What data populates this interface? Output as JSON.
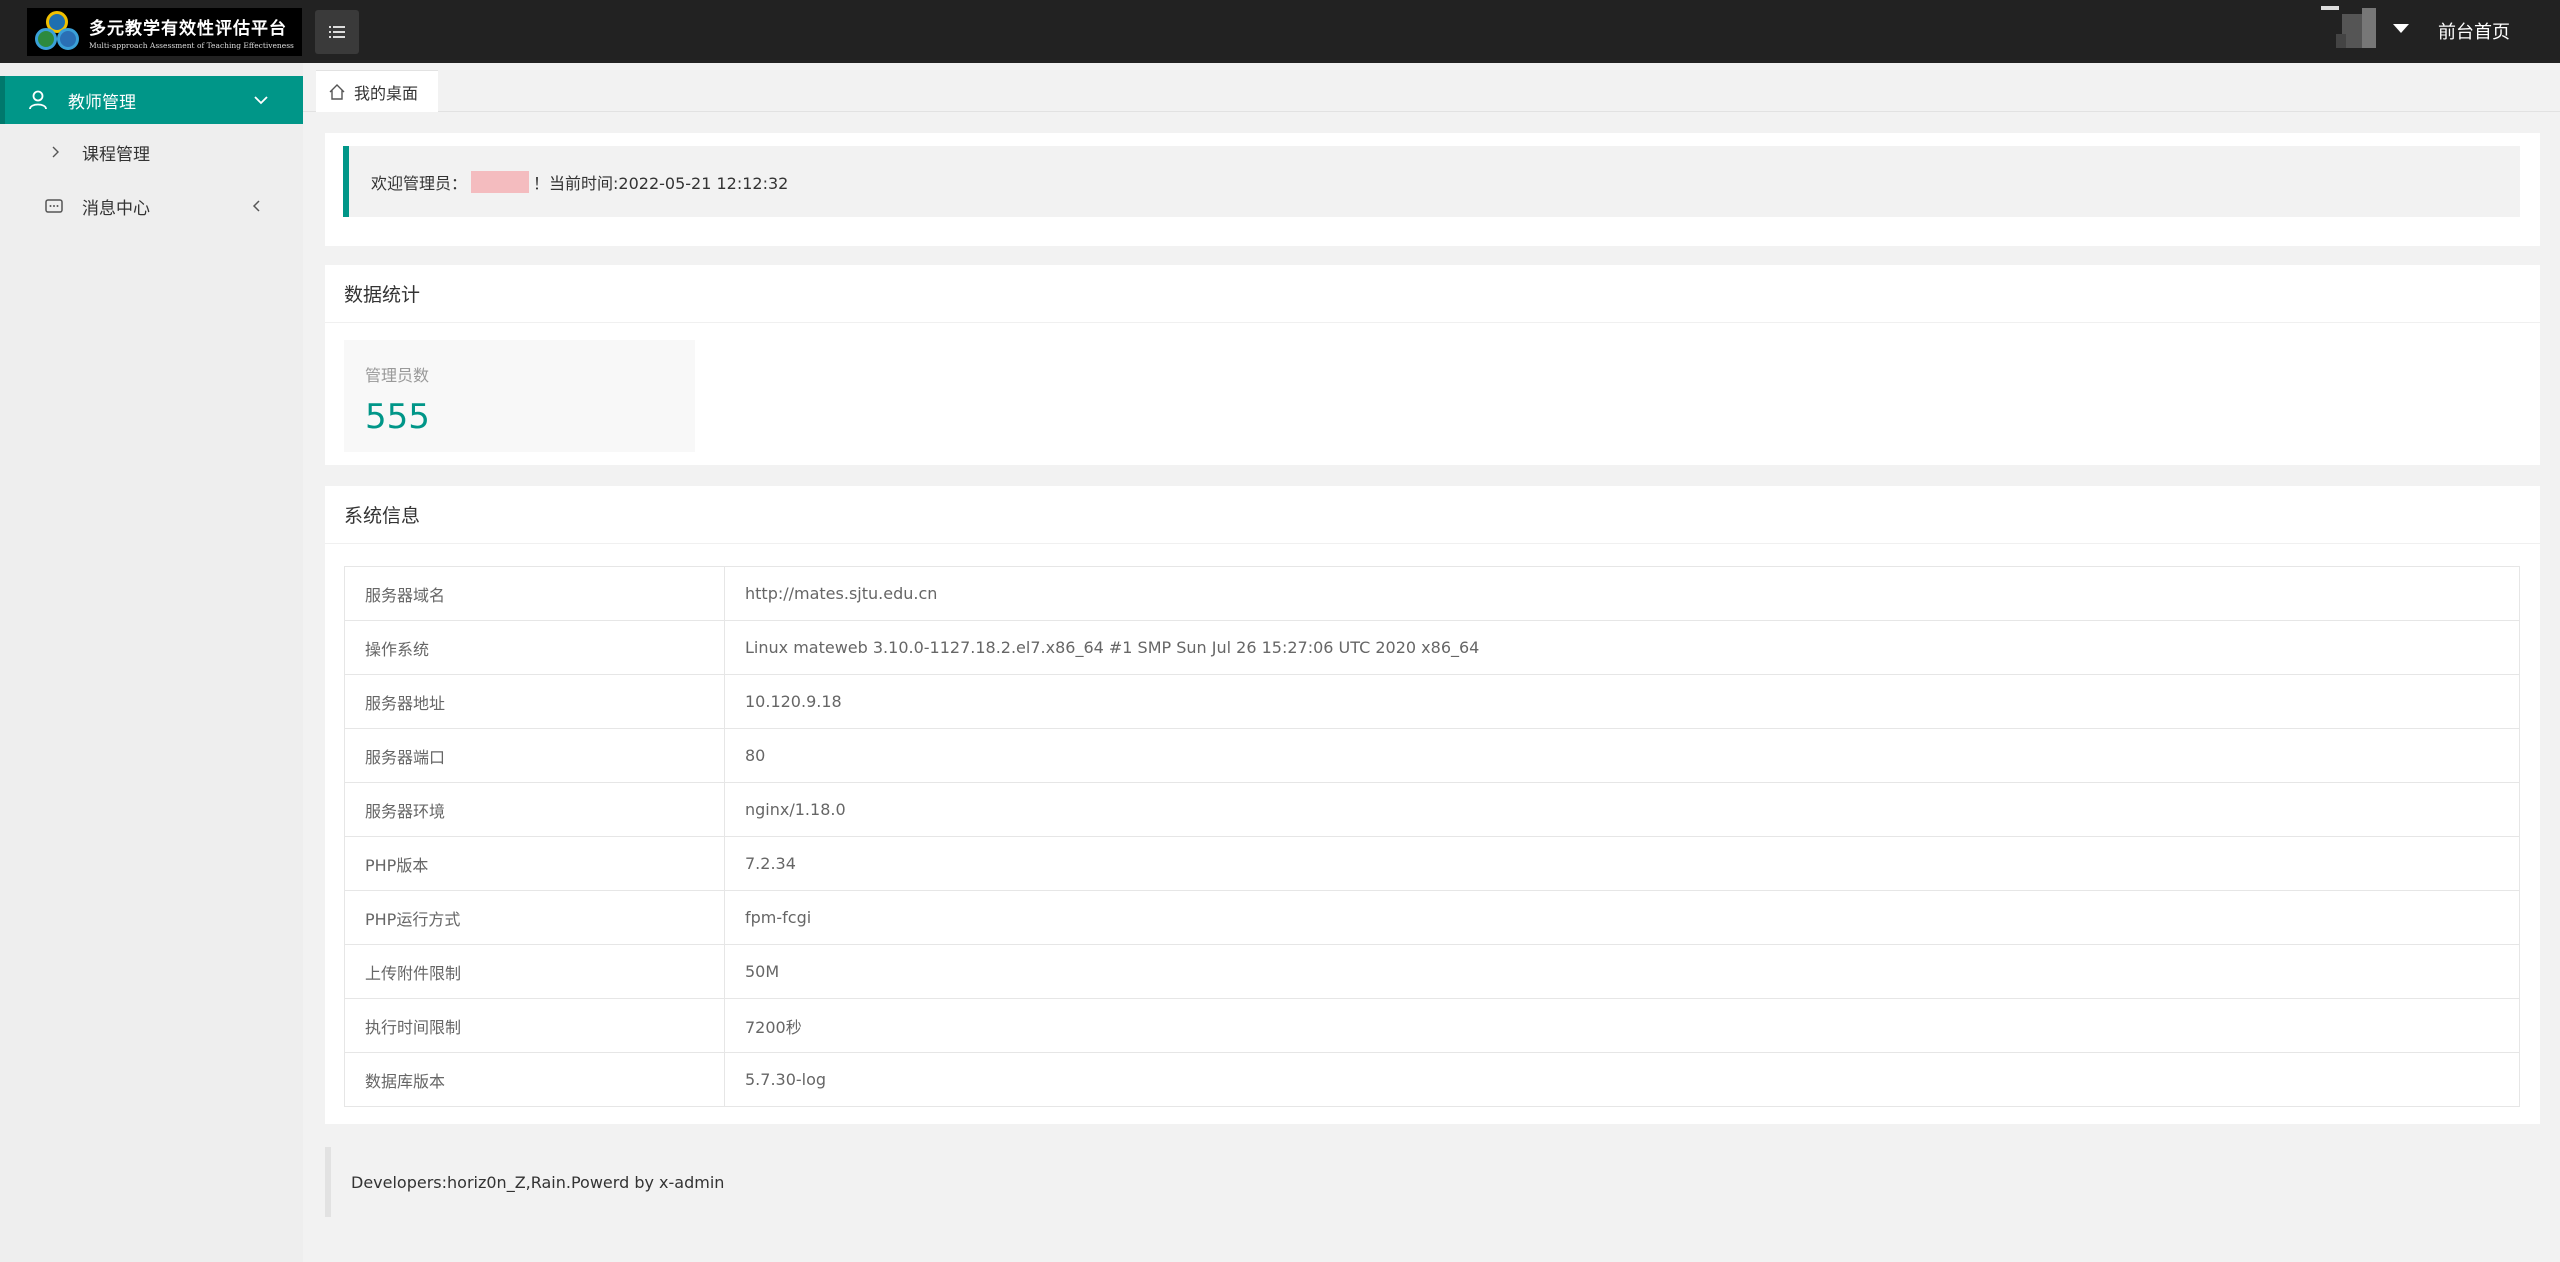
{
  "header": {
    "logo_title": "多元教学有效性评估平台",
    "logo_subtitle": "Multi-approach Assessment of Teaching Effectiveness",
    "front_link": "前台首页"
  },
  "sidebar": {
    "items": [
      {
        "label": "教师管理",
        "icon": "user-icon",
        "active": true
      },
      {
        "label": "课程管理",
        "icon": "chevron-right-icon",
        "active": false
      },
      {
        "label": "消息中心",
        "icon": "message-icon",
        "active": false
      }
    ]
  },
  "tabs": [
    {
      "label": "我的桌面",
      "icon": "home-icon"
    }
  ],
  "welcome": {
    "prefix": "欢迎管理员：",
    "suffix": "！当前时间:2022-05-21 12:12:32"
  },
  "stats": {
    "title": "数据统计",
    "label": "管理员数",
    "value": "555"
  },
  "system": {
    "title": "系统信息",
    "rows": [
      {
        "key": "服务器域名",
        "value": "http://mates.sjtu.edu.cn"
      },
      {
        "key": "操作系统",
        "value": "Linux mateweb 3.10.0-1127.18.2.el7.x86_64 #1 SMP Sun Jul 26 15:27:06 UTC 2020 x86_64"
      },
      {
        "key": "服务器地址",
        "value": "10.120.9.18"
      },
      {
        "key": "服务器端口",
        "value": "80"
      },
      {
        "key": "服务器环境",
        "value": "nginx/1.18.0"
      },
      {
        "key": "PHP版本",
        "value": "7.2.34"
      },
      {
        "key": "PHP运行方式",
        "value": "fpm-fcgi"
      },
      {
        "key": "上传附件限制",
        "value": "50M"
      },
      {
        "key": "执行时间限制",
        "value": "7200秒"
      },
      {
        "key": "数据库版本",
        "value": "5.7.30-log"
      }
    ]
  },
  "footer": {
    "text": "Developers:horiz0n_Z,Rain.Powerd by x-admin"
  },
  "colors": {
    "accent": "#009688",
    "header_bg": "#222222",
    "sidebar_bg": "#eeeeee"
  }
}
